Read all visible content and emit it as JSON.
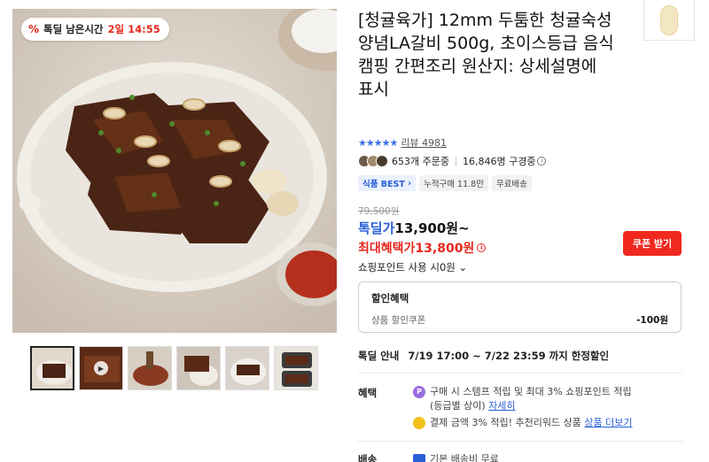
{
  "badge": {
    "label": "톡딜 남은시간",
    "time": "2일 14:55",
    "icon": "percent-icon"
  },
  "product": {
    "title": "[청귤육가] 12mm 두툼한 청귤숙성 양념LA갈비 500g, 초이스등급 음식 캠핑 간편조리 원산지: 상세설명에 표시",
    "rating_stars": 5,
    "review_label": "리뷰 4981",
    "orders": "653개 주문중",
    "subscribers": "16,846명 구경중",
    "tags": [
      "식품 BEST",
      "누적구매 11.8만",
      "무료배송"
    ]
  },
  "price": {
    "original": "79,500원",
    "deal_label": "톡딜가",
    "deal_value": "13,900원~",
    "max_label": "최대혜택가",
    "max_value": "13,800원",
    "coupon_button": "쿠폰 받기",
    "points": "쇼핑포인트 사용 시0원"
  },
  "discount": {
    "heading": "할인혜택",
    "row_label": "상품 할인쿠폰",
    "row_value": "-100원"
  },
  "deal_info": {
    "label": "톡딜 안내",
    "period": "7/19 17:00 ~ 7/22 23:59 까지 한정할인"
  },
  "benefit": {
    "label": "혜택",
    "line1_text": "구매 시 스탬프 적립 및 최대 3% 쇼핑포인트 적립",
    "line1_text2": "(등급별 상이)",
    "line1_link": "자세히",
    "line2_text": "결제 금액 3% 적립! 추천리워드 상품",
    "line2_link": "상품 더보기"
  },
  "shipping": {
    "label": "배송",
    "text": "기본 배송비 무료"
  },
  "colors": {
    "accent_blue": "#2a5fd8",
    "accent_red": "#e6281e",
    "coupon_red": "#f0281e"
  }
}
